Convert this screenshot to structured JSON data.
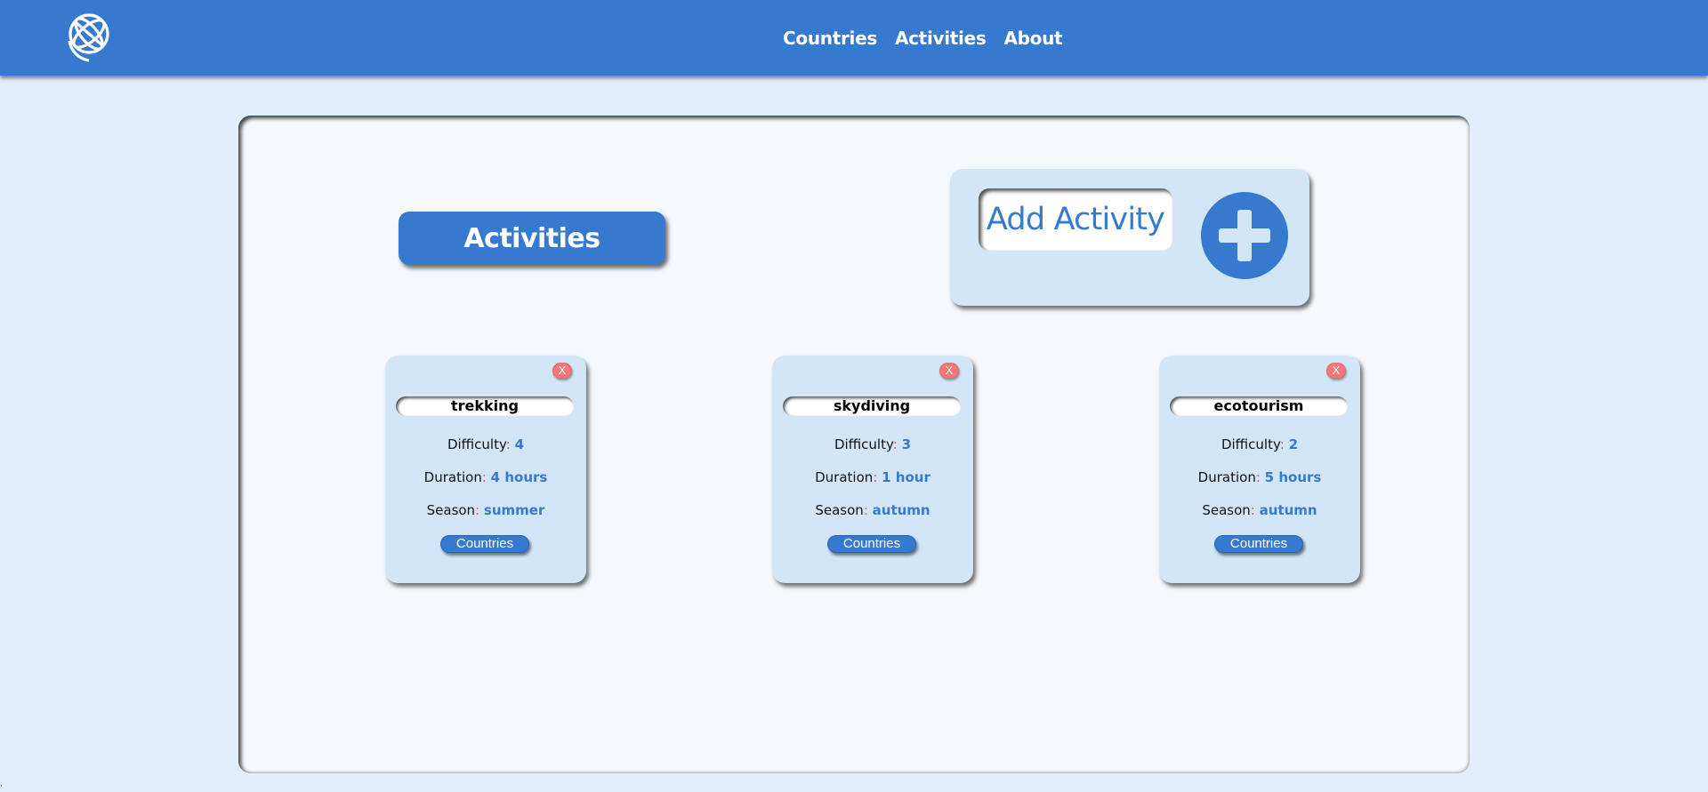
{
  "navbar": {
    "logo_icon": "globe-icon",
    "links": [
      "Countries",
      "Activities",
      "About"
    ],
    "bg_color": "#367acf"
  },
  "main": {
    "title": "Activities",
    "add_button": {
      "label": "Add Activity",
      "icon": "plus-icon"
    }
  },
  "activities": [
    {
      "name": "trekking",
      "difficulty_label": "Difficulty",
      "difficulty": "4",
      "duration_label": "Duration",
      "duration": "4 hours",
      "season_label": "Season",
      "season": "summer",
      "close_label": "X",
      "countries_label": "Countries"
    },
    {
      "name": "skydiving",
      "difficulty_label": "Difficulty",
      "difficulty": "3",
      "duration_label": "Duration",
      "duration": "1 hour",
      "season_label": "Season",
      "season": "autumn",
      "close_label": "X",
      "countries_label": "Countries"
    },
    {
      "name": "ecotourism",
      "difficulty_label": "Difficulty",
      "difficulty": "2",
      "duration_label": "Duration",
      "duration": "5 hours",
      "season_label": "Season",
      "season": "autumn",
      "close_label": "X",
      "countries_label": "Countries"
    }
  ],
  "corner_mark": ",",
  "colors": {
    "accent": "#367acf",
    "page_bg": "#e0eefd",
    "card_bg": "#d3e6f8",
    "close_red": "#f27777"
  }
}
